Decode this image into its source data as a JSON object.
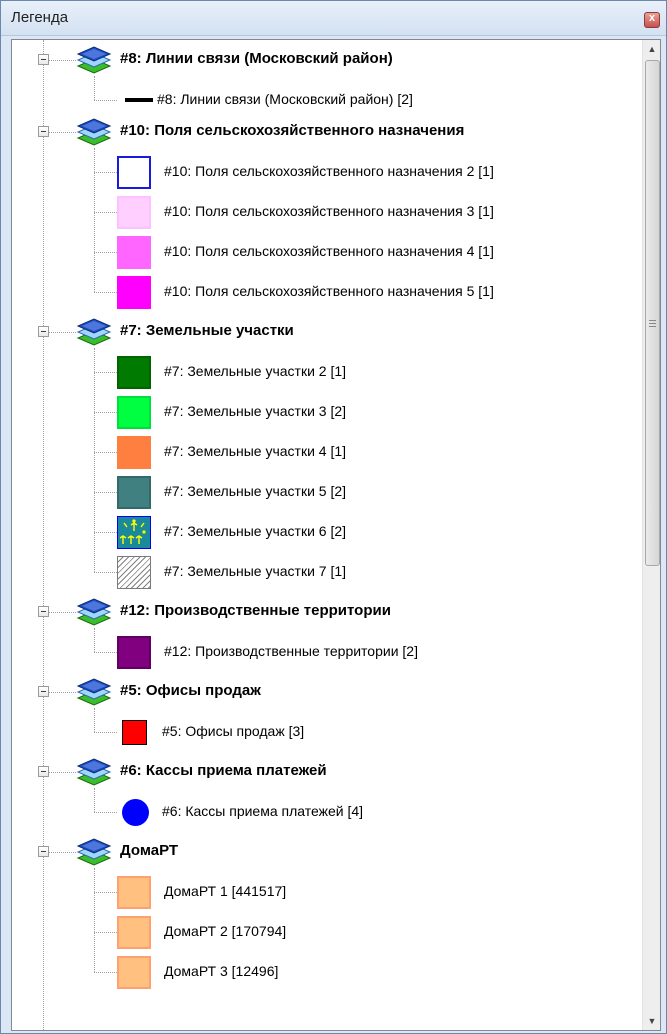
{
  "window": {
    "title": "Легенда",
    "close_icon": "close-icon"
  },
  "layers": [
    {
      "name": "#8: Линии связи (Московский район)",
      "items": [
        {
          "label": "#8: Линии связи (Московский район) [2]",
          "swatch": {
            "kind": "line",
            "color": "#000000"
          }
        }
      ]
    },
    {
      "name": "#10: Поля сельскохозяйственного назначения",
      "items": [
        {
          "label": "#10: Поля сельскохозяйственного назначения 2 [1]",
          "swatch": {
            "kind": "rect",
            "fill": "#ffffff",
            "border": "#1a1adf"
          }
        },
        {
          "label": "#10: Поля сельскохозяйственного назначения 3 [1]",
          "swatch": {
            "kind": "rect",
            "fill": "#ffd0ff",
            "border": "#ffc0ff"
          }
        },
        {
          "label": "#10: Поля сельскохозяйственного назначения 4 [1]",
          "swatch": {
            "kind": "rect",
            "fill": "#ff66ff",
            "border": "#ff66ff"
          }
        },
        {
          "label": "#10: Поля сельскохозяйственного назначения 5 [1]",
          "swatch": {
            "kind": "rect",
            "fill": "#ff00ff",
            "border": "#ff00ff"
          }
        }
      ]
    },
    {
      "name": "#7: Земельные участки",
      "items": [
        {
          "label": "#7: Земельные участки 2 [1]",
          "swatch": {
            "kind": "rect",
            "fill": "#007a00",
            "border": "#006400"
          }
        },
        {
          "label": "#7: Земельные участки 3 [2]",
          "swatch": {
            "kind": "rect",
            "fill": "#00ff40",
            "border": "#00e03a"
          }
        },
        {
          "label": "#7: Земельные участки 4 [1]",
          "swatch": {
            "kind": "rect",
            "fill": "#ff7f40",
            "border": "#ff7f40"
          }
        },
        {
          "label": "#7: Земельные участки 5 [2]",
          "swatch": {
            "kind": "rect",
            "fill": "#408080",
            "border": "#306a6a"
          }
        },
        {
          "label": "#7: Земельные участки 6 [2]",
          "swatch": {
            "kind": "pattern-marsh",
            "fill": "#1a8a9a",
            "border": "#0000ff"
          }
        },
        {
          "label": "#7: Земельные участки 7 [1]",
          "swatch": {
            "kind": "hatch",
            "fill": "#ffffff",
            "border": "#7a7a7a"
          }
        }
      ]
    },
    {
      "name": "#12: Производственные территории",
      "items": [
        {
          "label": "#12: Производственные территории [2]",
          "swatch": {
            "kind": "rect",
            "fill": "#800080",
            "border": "#600060"
          }
        }
      ]
    },
    {
      "name": "#5: Офисы продаж",
      "items": [
        {
          "label": "#5: Офисы продаж [3]",
          "swatch": {
            "kind": "square-point",
            "fill": "#ff0000",
            "border": "#000000"
          }
        }
      ]
    },
    {
      "name": "#6: Кассы приема платежей",
      "items": [
        {
          "label": "#6: Кассы приема платежей [4]",
          "swatch": {
            "kind": "circle-point",
            "fill": "#0000ff",
            "border": "#0000ff"
          }
        }
      ]
    },
    {
      "name": "ДомаРТ",
      "items": [
        {
          "label": "ДомаРТ 1 [441517]",
          "swatch": {
            "kind": "rect",
            "fill": "#ffc080",
            "border": "#ffa070"
          }
        },
        {
          "label": "ДомаРТ 2 [170794]",
          "swatch": {
            "kind": "rect",
            "fill": "#ffc080",
            "border": "#ffa070"
          }
        },
        {
          "label": "ДомаРТ 3 [12496]",
          "swatch": {
            "kind": "rect",
            "fill": "#ffc080",
            "border": "#ffa070"
          }
        }
      ]
    }
  ],
  "icons": {
    "layer": "layer-stack-icon",
    "expander": "collapse-icon",
    "scroll_up": "scroll-up-arrow-icon",
    "scroll_down": "scroll-down-arrow-icon"
  },
  "scrollbar": {
    "visible_fraction": 0.53
  }
}
